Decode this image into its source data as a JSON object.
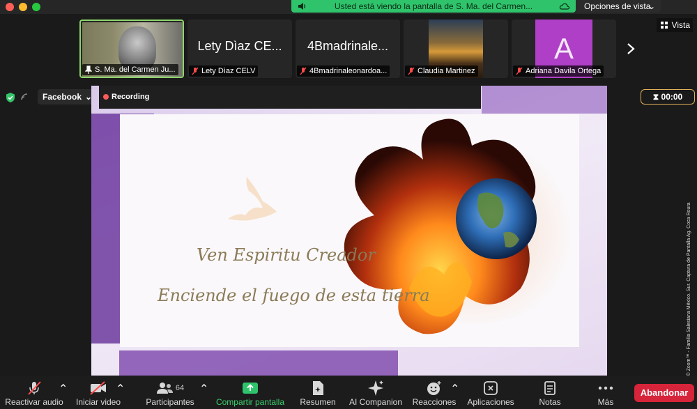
{
  "banner": {
    "share_text": "Usted está viendo la pantalla de S. Ma. del Carmen...",
    "view_options": "Opciones de vista"
  },
  "view_button": "Vista",
  "thumbnails": [
    {
      "name": "S. Ma. del Carmen Ju...",
      "big": ""
    },
    {
      "name": "Lety Dìaz CELV",
      "big": "Lety Dìaz CE..."
    },
    {
      "name": "4Bmadrinaleonardoa...",
      "big": "4Bmadrinale..."
    },
    {
      "name": "Claudia Martinez",
      "big": ""
    },
    {
      "name": "Adriana Davila Ortega",
      "big": "A"
    }
  ],
  "share_bar": {
    "stream_target": "Facebook",
    "recording": "Recording",
    "timer": "00:00"
  },
  "slide": {
    "line1": "Ven Espiritu Creador",
    "line2": "Enciende el fuego de esta tierra"
  },
  "credit": "Cortesía © Zoom™ - Familia Salesiana México. Sur. Captura de Pantalla Ag. Coca Roura",
  "toolbar": {
    "audio": "Reactivar audio",
    "video": "Iniciar video",
    "participants": "Participantes",
    "participants_count": "64",
    "share": "Compartir pantalla",
    "summary": "Resumen",
    "ai": "AI Companion",
    "reactions": "Reacciones",
    "apps": "Aplicaciones",
    "notes": "Notas",
    "more": "Más",
    "leave": "Abandonar"
  },
  "colors": {
    "share_green": "#2fc46b",
    "leave_red": "#d6243a",
    "slide_purple": "#6d3a9f",
    "active_border": "#8cd66b"
  }
}
